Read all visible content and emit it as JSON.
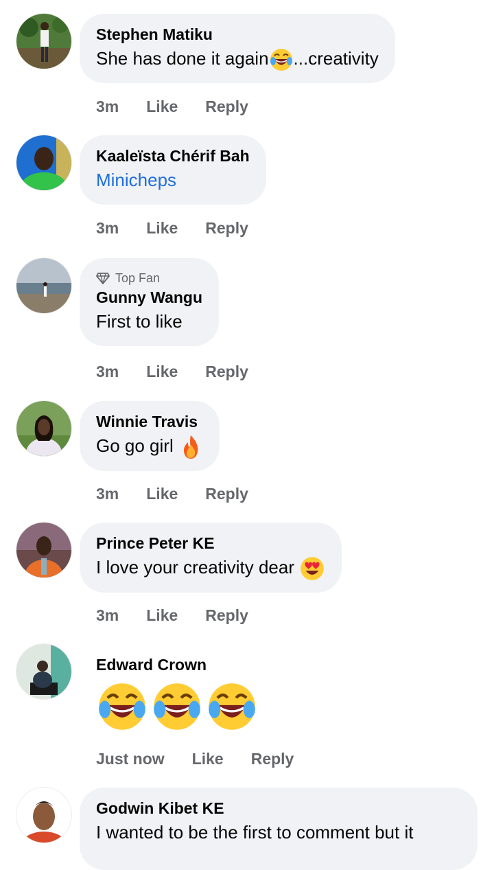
{
  "comments": [
    {
      "author": "Stephen Matiku",
      "text": "She has done it again",
      "text_after": "...creativity",
      "time": "3m",
      "like": "Like",
      "reply": "Reply",
      "avatar_icon": "person-outdoor-avatar"
    },
    {
      "author": "Kaaleïsta Chérif Bah",
      "text": "Minicheps",
      "time": "3m",
      "like": "Like",
      "reply": "Reply",
      "avatar_icon": "person-green-shirt-avatar"
    },
    {
      "badge": "Top Fan",
      "author": "Gunny Wangu",
      "text": "First to like",
      "time": "3m",
      "like": "Like",
      "reply": "Reply",
      "avatar_icon": "beach-avatar"
    },
    {
      "author": "Winnie Travis",
      "text": "Go go girl",
      "time": "3m",
      "like": "Like",
      "reply": "Reply",
      "avatar_icon": "woman-avatar"
    },
    {
      "author": "Prince Peter KE",
      "text": "I love your creativity dear",
      "time": "3m",
      "like": "Like",
      "reply": "Reply",
      "avatar_icon": "man-orange-avatar"
    },
    {
      "author": "Edward Crown",
      "text": "",
      "time": "Just now",
      "like": "Like",
      "reply": "Reply",
      "avatar_icon": "man-motorbike-avatar"
    },
    {
      "author": "Godwin Kibet KE",
      "text": "I wanted to be the first to comment but it",
      "avatar_icon": "cartoon-man-avatar"
    }
  ],
  "colors": {
    "bubble": "#f0f2f5",
    "action": "#65676b",
    "link": "#216fdb"
  }
}
